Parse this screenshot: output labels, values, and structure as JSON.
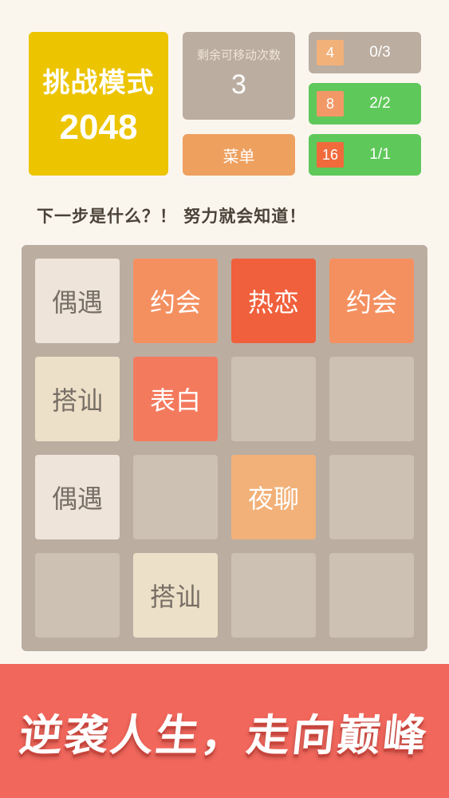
{
  "logo": {
    "line1": "挑战模式",
    "line2": "2048"
  },
  "moves": {
    "label": "剩余可移动次数",
    "value": "3"
  },
  "menu_label": "菜单",
  "goals": [
    {
      "tile": "4",
      "progress": "0/3",
      "status": "pending"
    },
    {
      "tile": "8",
      "progress": "2/2",
      "status": "done"
    },
    {
      "tile": "16",
      "progress": "1/1",
      "status": "done"
    }
  ],
  "hint": "下一步是什么？！ 努力就会知道！",
  "board": {
    "rows": [
      [
        "偶遇",
        "约会",
        "热恋",
        "约会"
      ],
      [
        "搭讪",
        "表白",
        "",
        ""
      ],
      [
        "偶遇",
        "",
        "夜聊",
        ""
      ],
      [
        "",
        "搭讪",
        "",
        ""
      ]
    ]
  },
  "banner": "逆袭人生，走向巅峰",
  "colors": {
    "logo": "#ecc400",
    "goal_done": "#5fc85a",
    "goal_pending": "#bbada0",
    "banner": "#f2675c",
    "board": "#bbada0"
  }
}
